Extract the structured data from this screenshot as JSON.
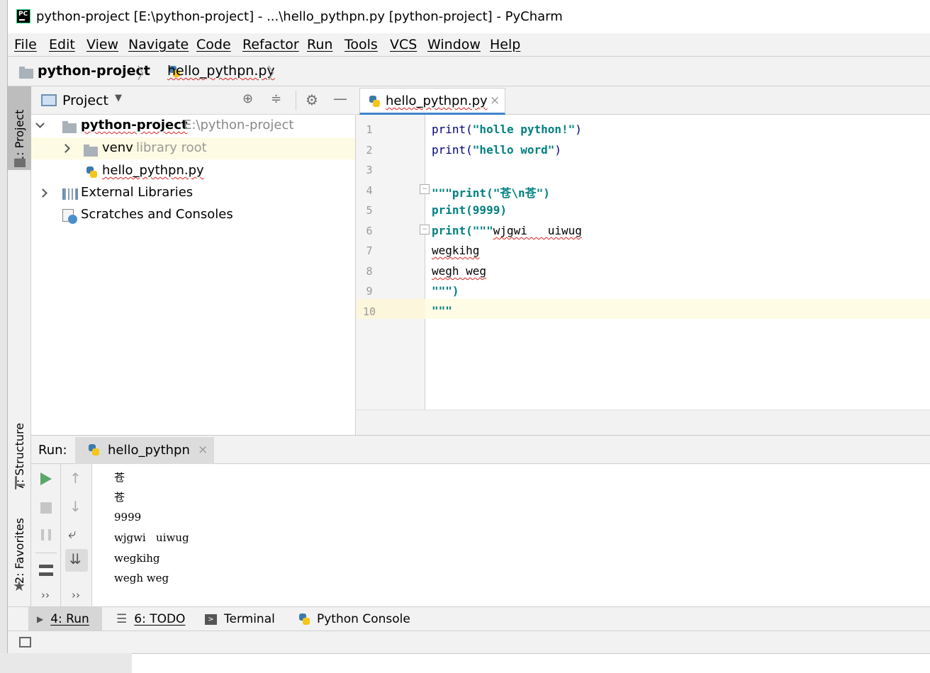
{
  "window": {
    "title": "python-project [E:\\python-project] - ...\\hello_pythpn.py [python-project] - PyCharm",
    "logo_text": "PC"
  },
  "menu": [
    "File",
    "Edit",
    "View",
    "Navigate",
    "Code",
    "Refactor",
    "Run",
    "Tools",
    "VCS",
    "Window",
    "Help"
  ],
  "breadcrumb": {
    "project": "python-project",
    "file": "hello_pythpn.py"
  },
  "left_stripe": {
    "project_tab": "1: Project",
    "structure_tab": "7: Structure",
    "favorites_tab": "2: Favorites"
  },
  "project_panel": {
    "header": "Project",
    "tree": {
      "root_name": "python-project",
      "root_path": "E:\\python-project",
      "venv": "venv",
      "venv_note": "library root",
      "file": "hello_pythpn.py",
      "external": "External Libraries",
      "scratches": "Scratches and Consoles"
    }
  },
  "editor": {
    "tab_label": "hello_pythpn.py",
    "line_numbers": [
      "1",
      "2",
      "3",
      "4",
      "5",
      "6",
      "7",
      "8",
      "9",
      "10"
    ],
    "lines": {
      "l1_fn": "print(",
      "l1_str": "\"holle python!\"",
      "l1_end": ")",
      "l2_fn": "print(",
      "l2_str": "\"hello word\"",
      "l2_end": ")",
      "l4": "\"\"\"print(\"苍\\n苍\")",
      "l5": "print(9999)",
      "l6_fn": "print(\"\"\"",
      "l6_rest": "wjgwi   uiwug",
      "l7": "wegkihg",
      "l8": "wegh weg",
      "l9": "\"\"\")",
      "l10": "\"\"\""
    }
  },
  "run_panel": {
    "label": "Run:",
    "tab": "hello_pythpn",
    "output": [
      "苍",
      "苍",
      "9999",
      "wjgwi   uiwug",
      "wegkihg",
      "wegh weg"
    ]
  },
  "bottom_tools": {
    "run": "4: Run",
    "todo": "6: TODO",
    "terminal": "Terminal",
    "python_console": "Python Console"
  }
}
